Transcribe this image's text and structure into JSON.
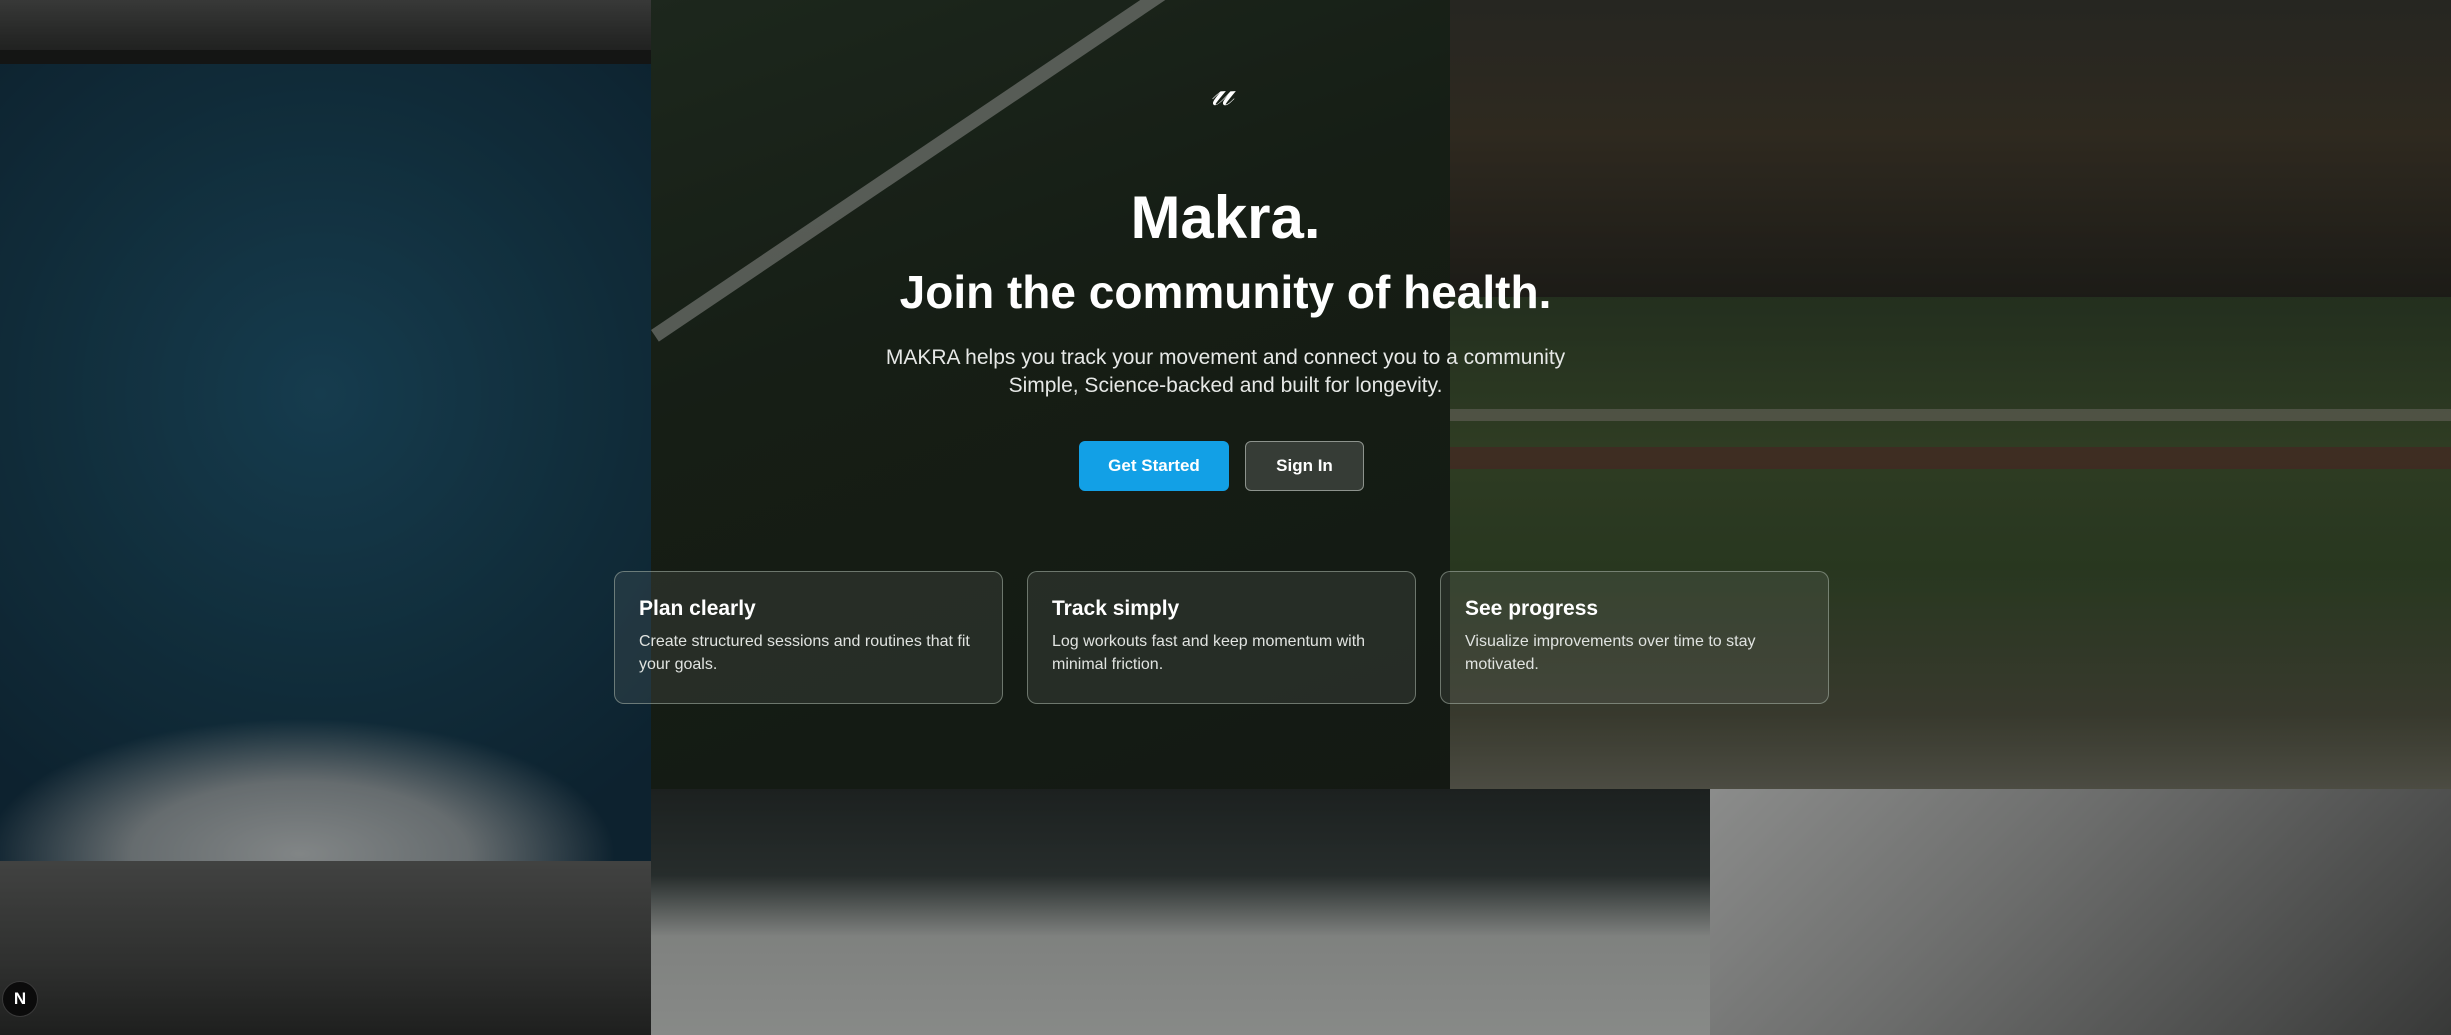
{
  "hero": {
    "logo_glyph": "𝓊",
    "title": "Makra.",
    "subtitle": "Join the community of health.",
    "description_line1": "MAKRA helps you track your movement and connect you to a community",
    "description_line2": "Simple, Science-backed and built for longevity."
  },
  "actions": {
    "get_started_label": "Get Started",
    "sign_in_label": "Sign In"
  },
  "features": [
    {
      "title": "Plan clearly",
      "text": "Create structured sessions and routines that fit your goals."
    },
    {
      "title": "Track simply",
      "text": "Log workouts fast and keep momentum with minimal friction."
    },
    {
      "title": "See progress",
      "text": "Visualize improvements over time to stay motivated."
    }
  ],
  "dev_badge": {
    "label": "N"
  },
  "colors": {
    "primary_button": "#12a0e6",
    "text": "#ffffff"
  }
}
